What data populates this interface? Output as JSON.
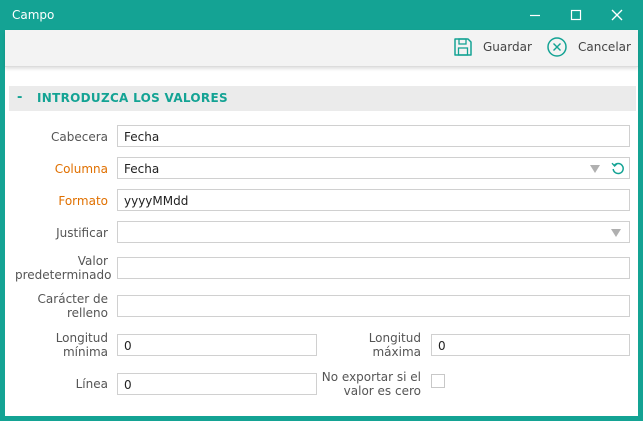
{
  "window": {
    "title": "Campo"
  },
  "toolbar": {
    "save_label": "Guardar",
    "cancel_label": "Cancelar"
  },
  "section": {
    "toggle": "-",
    "title": "INTRODUZCA LOS VALORES"
  },
  "form": {
    "cabecera": {
      "label": "Cabecera",
      "value": "Fecha"
    },
    "columna": {
      "label": "Columna",
      "value": "Fecha"
    },
    "formato": {
      "label": "Formato",
      "value": "yyyyMMdd"
    },
    "justificar": {
      "label": "Justificar",
      "value": ""
    },
    "valor_predeterminado": {
      "label_1": "Valor",
      "label_2": "predeterminado",
      "value": ""
    },
    "caracter_relleno": {
      "label_1": "Carácter de",
      "label_2": "relleno",
      "value": ""
    },
    "longitud_minima": {
      "label_1": "Longitud",
      "label_2": "mínima",
      "value": "0"
    },
    "longitud_maxima": {
      "label_1": "Longitud",
      "label_2": "máxima",
      "value": "0"
    },
    "linea": {
      "label": "Línea",
      "value": "0"
    },
    "no_exportar": {
      "label_1": "No exportar si el",
      "label_2": "valor es cero",
      "checked": false
    }
  },
  "colors": {
    "accent": "#14a394",
    "required_label": "#e07000"
  },
  "icons": {
    "minimize": "minimize-icon",
    "maximize": "maximize-icon",
    "close": "close-icon",
    "save": "save-icon",
    "cancel": "cancel-icon",
    "dropdown": "dropdown-arrow-icon",
    "refresh": "refresh-icon"
  }
}
